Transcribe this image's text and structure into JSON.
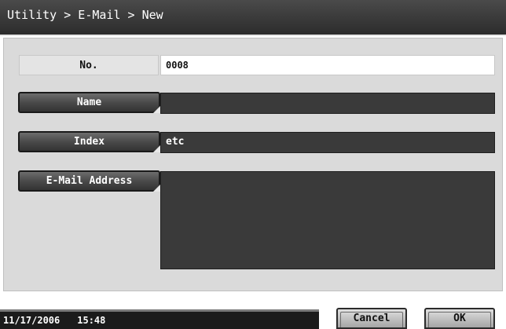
{
  "header": {
    "breadcrumb": "Utility > E-Mail > New"
  },
  "form": {
    "no_label": "No.",
    "no_value": "0008",
    "name_button": "Name",
    "name_value": "",
    "index_button": "Index",
    "index_value": "etc",
    "email_button": "E-Mail Address",
    "email_value": ""
  },
  "status": {
    "date": "11/17/2006",
    "time": "15:48"
  },
  "footer": {
    "cancel_label": "Cancel",
    "ok_label": "OK"
  },
  "colors": {
    "title_bar": "#3a3a3a",
    "panel": "#dadada",
    "field_dark": "#3a3a3a",
    "status_bar": "#1b1b1b"
  }
}
